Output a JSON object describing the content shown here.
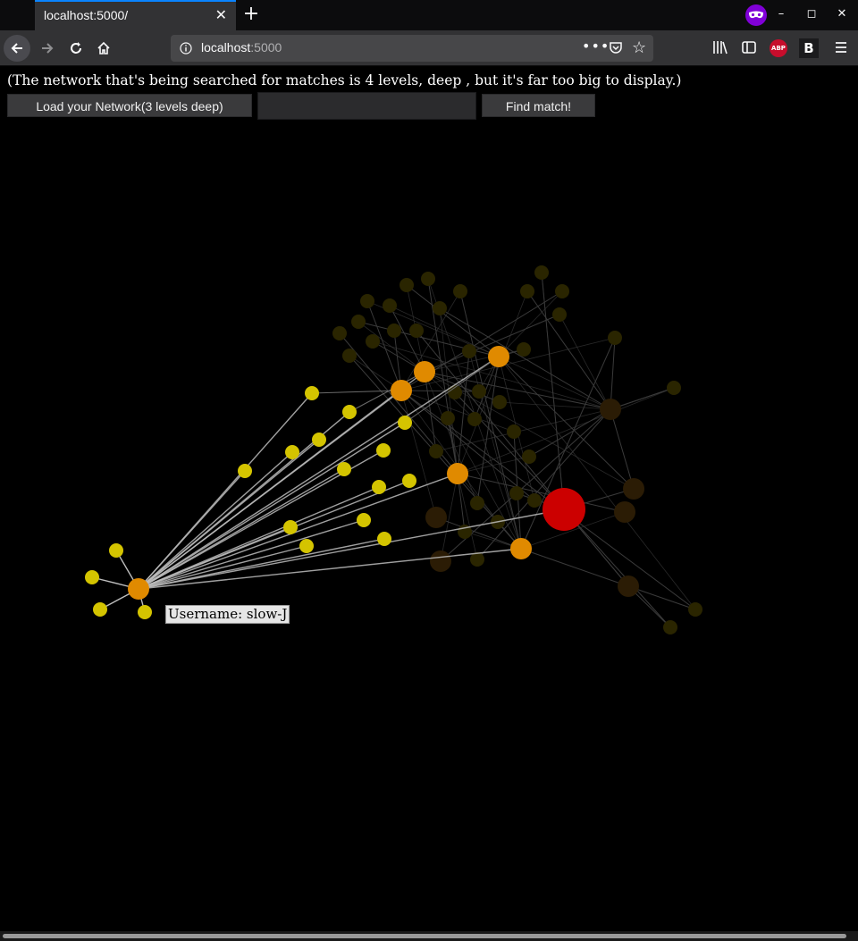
{
  "browser": {
    "tab_title": "localhost:5000/",
    "url_host": "localhost",
    "url_port": ":5000",
    "abp_label": "ABP",
    "ext_label": "B"
  },
  "page": {
    "intro_text": "(The network that's being searched for matches is 4 levels, deep , but it's far too big to display.)",
    "load_button": "Load your Network(3 levels deep)",
    "search_value": "",
    "find_button": "Find match!",
    "tooltip": "Username: slow-J"
  },
  "colors": {
    "background": "#000000",
    "level1": "#d4c400",
    "level2": "#e08a00",
    "center": "#cc0000",
    "link_active": "#bdbdbd",
    "link_faded": "#3a3a3a"
  },
  "graph": {
    "hovered_node": "slow-J"
  }
}
